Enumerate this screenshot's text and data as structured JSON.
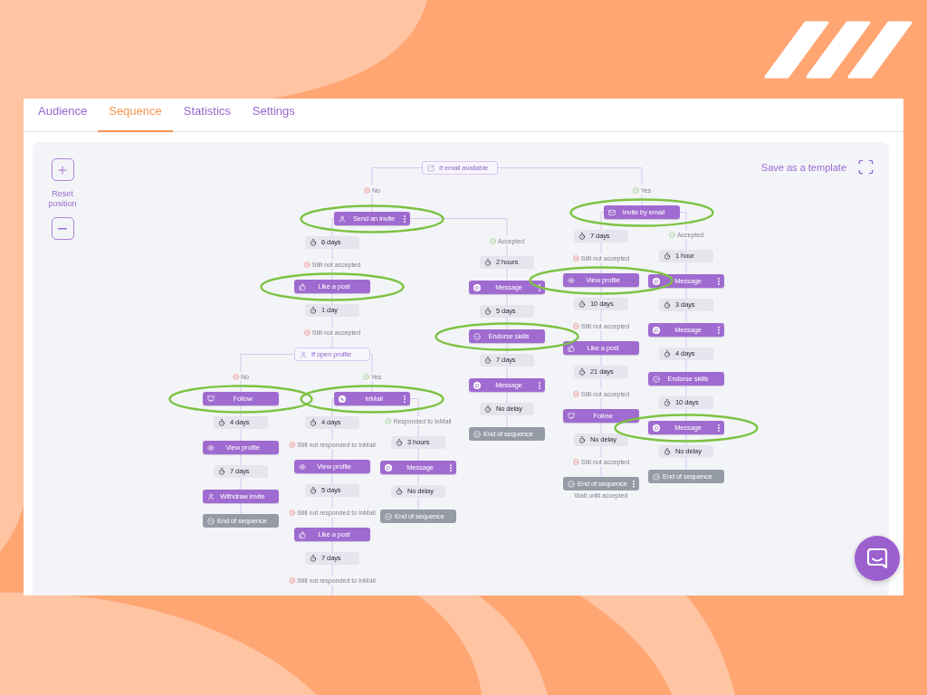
{
  "tabs": [
    {
      "label": "Audience",
      "selected": false
    },
    {
      "label": "Sequence",
      "selected": true
    },
    {
      "label": "Statistics",
      "selected": false
    },
    {
      "label": "Settings",
      "selected": false
    }
  ],
  "canvas_controls": {
    "reset_position": "Reset position",
    "save_template": "Save as a template"
  },
  "flow": {
    "kind": "mailcheck",
    "text": "If email available",
    "branches": [
      {
        "steps": [
          {
            "kind": "negative",
            "text": "No"
          },
          {
            "kind": "invite",
            "text": "Send an invite",
            "menu": true,
            "highlighted": true,
            "branches": [
              {
                "steps": [
                  {
                    "kind": "delay",
                    "text": "6 days"
                  },
                  {
                    "kind": "negative",
                    "text": "Still not accepted"
                  },
                  {
                    "kind": "like",
                    "text": "Like a post",
                    "menu": false,
                    "highlighted": true
                  },
                  {
                    "kind": "delay",
                    "text": "1 day"
                  },
                  {
                    "kind": "negative",
                    "text": "Still not accepted"
                  },
                  {
                    "kind": "profilecheck",
                    "text": "If open profile",
                    "branches": [
                      {
                        "steps": [
                          {
                            "kind": "negative",
                            "text": "No"
                          },
                          {
                            "kind": "follow",
                            "text": "Follow",
                            "menu": false,
                            "highlighted": true
                          },
                          {
                            "kind": "delay",
                            "text": "4 days"
                          },
                          {
                            "kind": "view",
                            "text": "View profile",
                            "menu": false,
                            "highlighted": false
                          },
                          {
                            "kind": "delay",
                            "text": "7 days"
                          },
                          {
                            "kind": "withdraw",
                            "text": "Withdraw invite",
                            "menu": false,
                            "highlighted": false
                          },
                          {
                            "kind": "end",
                            "text": "End of sequence",
                            "menu": false,
                            "highlighted": false
                          }
                        ]
                      },
                      {
                        "steps": [
                          {
                            "kind": "positive",
                            "text": "Yes"
                          },
                          {
                            "kind": "inmail",
                            "text": "InMail",
                            "menu": true,
                            "highlighted": true,
                            "branches": [
                              {
                                "steps": [
                                  {
                                    "kind": "delay",
                                    "text": "4 days"
                                  },
                                  {
                                    "kind": "negative",
                                    "text": "Still not responded to InMail"
                                  },
                                  {
                                    "kind": "view",
                                    "text": "View profile",
                                    "menu": false,
                                    "highlighted": false
                                  },
                                  {
                                    "kind": "delay",
                                    "text": "5 days"
                                  },
                                  {
                                    "kind": "negative",
                                    "text": "Still not responded to InMail"
                                  },
                                  {
                                    "kind": "like",
                                    "text": "Like a post",
                                    "menu": false,
                                    "highlighted": false
                                  },
                                  {
                                    "kind": "delay",
                                    "text": "7 days"
                                  },
                                  {
                                    "kind": "negative",
                                    "text": "Still not responded to InMail"
                                  }
                                ]
                              },
                              {
                                "steps": [
                                  {
                                    "kind": "positive",
                                    "text": "Responded to InMail"
                                  },
                                  {
                                    "kind": "delay",
                                    "text": "3 hours"
                                  },
                                  {
                                    "kind": "message",
                                    "text": "Message",
                                    "menu": true,
                                    "highlighted": false
                                  },
                                  {
                                    "kind": "delay",
                                    "text": "No delay"
                                  },
                                  {
                                    "kind": "end",
                                    "text": "End of sequence",
                                    "menu": false,
                                    "highlighted": false
                                  }
                                ]
                              }
                            ]
                          }
                        ]
                      }
                    ]
                  }
                ]
              },
              {
                "steps": [
                  {
                    "kind": "positive",
                    "text": "Accepted"
                  },
                  {
                    "kind": "delay",
                    "text": "2 hours"
                  },
                  {
                    "kind": "message",
                    "text": "Message",
                    "menu": true,
                    "highlighted": false
                  },
                  {
                    "kind": "delay",
                    "text": "5 days"
                  },
                  {
                    "kind": "endorse",
                    "text": "Endorse skills",
                    "menu": false,
                    "highlighted": true
                  },
                  {
                    "kind": "delay",
                    "text": "7 days"
                  },
                  {
                    "kind": "message",
                    "text": "Message",
                    "menu": true,
                    "highlighted": false
                  },
                  {
                    "kind": "delay",
                    "text": "No delay"
                  },
                  {
                    "kind": "end",
                    "text": "End of sequence",
                    "menu": false,
                    "highlighted": false
                  }
                ]
              }
            ]
          }
        ]
      },
      {
        "steps": [
          {
            "kind": "positive",
            "text": "Yes"
          },
          {
            "kind": "email",
            "text": "Invite by email",
            "menu": false,
            "highlighted": true,
            "branches": [
              {
                "steps": [
                  {
                    "kind": "delay",
                    "text": "7 days"
                  },
                  {
                    "kind": "negative",
                    "text": "Still not accepted"
                  },
                  {
                    "kind": "view",
                    "text": "View profile",
                    "menu": false,
                    "highlighted": true
                  },
                  {
                    "kind": "delay",
                    "text": "10 days"
                  },
                  {
                    "kind": "negative",
                    "text": "Still not accepted"
                  },
                  {
                    "kind": "like",
                    "text": "Like a post",
                    "menu": false,
                    "highlighted": false
                  },
                  {
                    "kind": "delay",
                    "text": "21 days"
                  },
                  {
                    "kind": "negative",
                    "text": "Still not accepted"
                  },
                  {
                    "kind": "follow",
                    "text": "Follow",
                    "menu": false,
                    "highlighted": false
                  },
                  {
                    "kind": "delay",
                    "text": "No delay"
                  },
                  {
                    "kind": "negative",
                    "text": "Still not accepted"
                  },
                  {
                    "kind": "end",
                    "text": "End of sequence",
                    "menu": true,
                    "highlighted": false,
                    "note": "Wait until accepted"
                  }
                ]
              },
              {
                "steps": [
                  {
                    "kind": "positive",
                    "text": "Accepted"
                  },
                  {
                    "kind": "delay",
                    "text": "1 hour"
                  },
                  {
                    "kind": "message",
                    "text": "Message",
                    "menu": true,
                    "highlighted": false
                  },
                  {
                    "kind": "delay",
                    "text": "3 days"
                  },
                  {
                    "kind": "message",
                    "text": "Message",
                    "menu": true,
                    "highlighted": false
                  },
                  {
                    "kind": "delay",
                    "text": "4 days"
                  },
                  {
                    "kind": "endorse",
                    "text": "Endorse skills",
                    "menu": false,
                    "highlighted": false
                  },
                  {
                    "kind": "delay",
                    "text": "10 days"
                  },
                  {
                    "kind": "message",
                    "text": "Message",
                    "menu": true,
                    "highlighted": true
                  },
                  {
                    "kind": "delay",
                    "text": "No delay"
                  },
                  {
                    "kind": "end",
                    "text": "End of sequence",
                    "menu": false,
                    "highlighted": false
                  }
                ]
              }
            ]
          }
        ]
      }
    ]
  }
}
